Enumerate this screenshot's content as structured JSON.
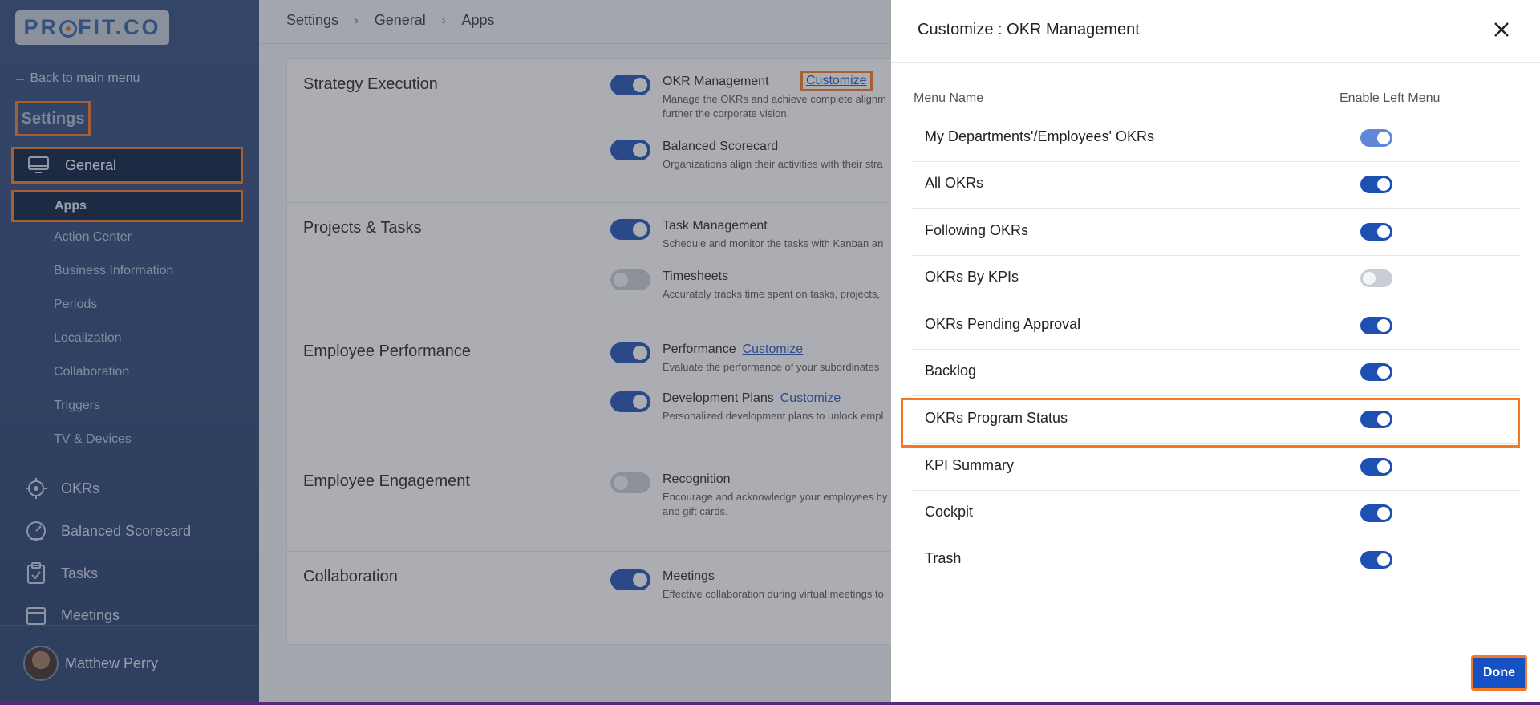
{
  "brand": {
    "logo_text_before": "PR",
    "logo_text_after": "FIT.CO"
  },
  "sidebar": {
    "back_link": "← Back to main menu",
    "title": "Settings",
    "general_label": "General",
    "apps_label": "Apps",
    "sub_items": [
      "Action Center",
      "Business Information",
      "Periods",
      "Localization",
      "Collaboration",
      "Triggers",
      "TV & Devices"
    ],
    "main_items": [
      "OKRs",
      "Balanced Scorecard",
      "Tasks",
      "Meetings"
    ],
    "user_name": "Matthew Perry"
  },
  "breadcrumb": {
    "items": [
      "Settings",
      "General",
      "Apps"
    ],
    "separator": "›"
  },
  "sections": [
    {
      "title": "Strategy Execution",
      "apps": [
        {
          "name": "OKR Management",
          "link": "Customize",
          "desc": "Manage the OKRs and achieve complete alignm further the corporate vision.",
          "enabled": true
        },
        {
          "name": "Balanced Scorecard",
          "link": "",
          "desc": "Organizations align their activities with their stra",
          "enabled": true
        }
      ]
    },
    {
      "title": "Projects & Tasks",
      "apps": [
        {
          "name": "Task Management",
          "link": "",
          "desc": "Schedule and monitor the tasks with Kanban an",
          "enabled": true
        },
        {
          "name": "Timesheets",
          "link": "",
          "desc": "Accurately tracks time spent on tasks, projects,",
          "enabled": false
        }
      ]
    },
    {
      "title": "Employee Performance",
      "apps": [
        {
          "name": "Performance",
          "link": "Customize",
          "desc": "Evaluate the performance of your subordinates",
          "enabled": true
        },
        {
          "name": "Development Plans",
          "link": "Customize",
          "desc": "Personalized development plans to unlock empl",
          "enabled": true
        }
      ]
    },
    {
      "title": "Employee Engagement",
      "apps": [
        {
          "name": "Recognition",
          "link": "",
          "desc": "Encourage and acknowledge your employees by and gift cards.",
          "enabled": false
        }
      ]
    },
    {
      "title": "Collaboration",
      "apps": [
        {
          "name": "Meetings",
          "link": "",
          "desc": "Effective collaboration during virtual meetings to",
          "enabled": true
        }
      ]
    }
  ],
  "drawer": {
    "title": "Customize : OKR Management",
    "col_menu_name": "Menu Name",
    "col_enable": "Enable Left Menu",
    "rows": [
      {
        "label": "My Departments'/Employees' OKRs",
        "enabled": true,
        "locked": true
      },
      {
        "label": "All OKRs",
        "enabled": true
      },
      {
        "label": "Following OKRs",
        "enabled": true
      },
      {
        "label": "OKRs By KPIs",
        "enabled": false
      },
      {
        "label": "OKRs Pending Approval",
        "enabled": true
      },
      {
        "label": "Backlog",
        "enabled": true
      },
      {
        "label": "OKRs Program Status",
        "enabled": true,
        "highlighted": true
      },
      {
        "label": "KPI Summary",
        "enabled": true
      },
      {
        "label": "Cockpit",
        "enabled": true
      },
      {
        "label": "Trash",
        "enabled": true
      }
    ],
    "done_label": "Done"
  },
  "colors": {
    "accent": "#1e4fb3",
    "highlight": "#f47721",
    "sidebar": "#2e4a7c"
  }
}
